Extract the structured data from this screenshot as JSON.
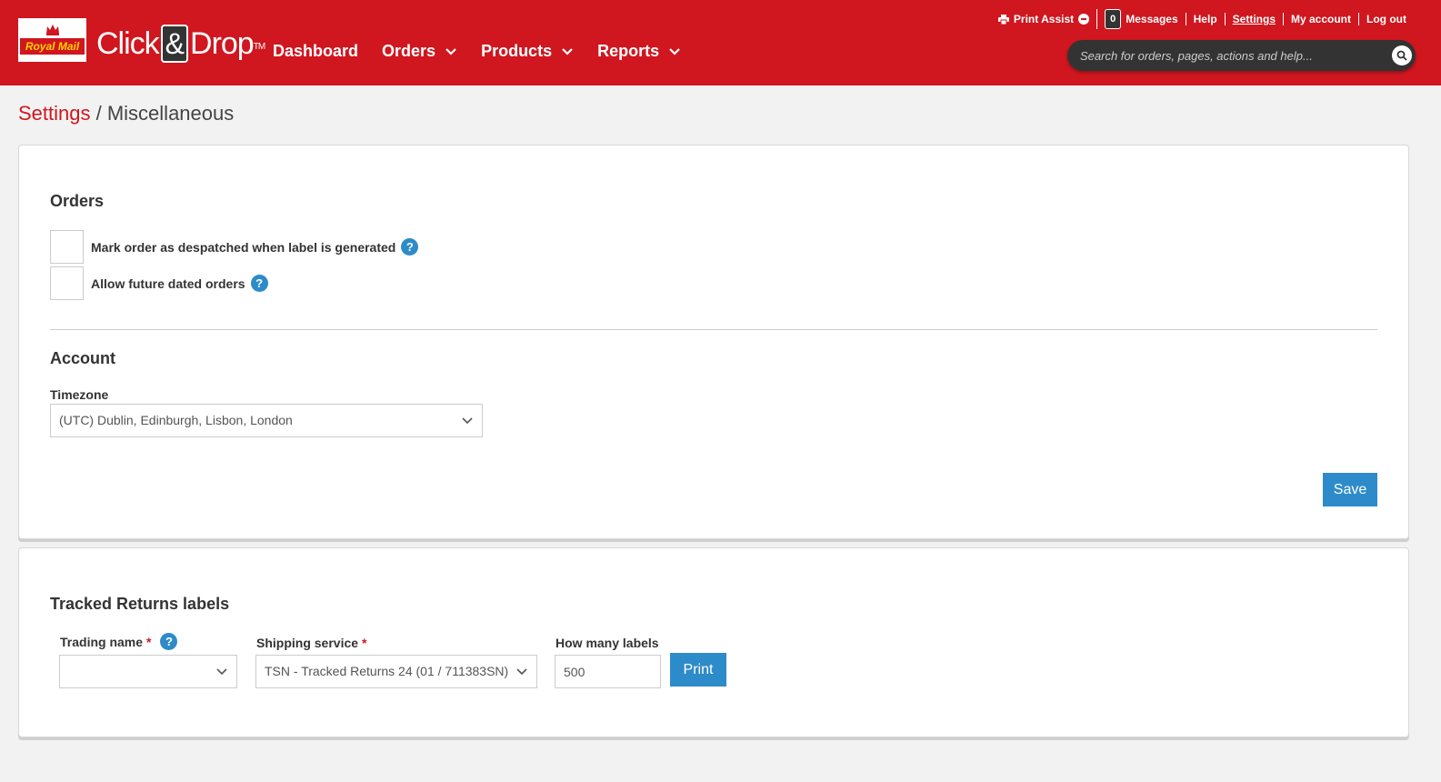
{
  "header": {
    "logo_text": "Royal Mail",
    "brand_pre": "Click",
    "brand_amp": "&",
    "brand_post": "Drop",
    "brand_tm": "TM",
    "nav": [
      {
        "label": "Dashboard"
      },
      {
        "label": "Orders"
      },
      {
        "label": "Products"
      },
      {
        "label": "Reports"
      }
    ],
    "toplinks": {
      "print_assist": "Print Assist",
      "message_count": "0",
      "messages": "Messages",
      "help": "Help",
      "settings": "Settings",
      "my_account": "My account",
      "log_out": "Log out"
    },
    "search_placeholder": "Search for orders, pages, actions and help..."
  },
  "breadcrumb": {
    "parent": "Settings",
    "separator": " / ",
    "current": "Miscellaneous"
  },
  "orders_section": {
    "title": "Orders",
    "options": [
      {
        "label": "Mark order as despatched when label is generated",
        "checked": false
      },
      {
        "label": "Allow future dated orders",
        "checked": false
      }
    ]
  },
  "account_section": {
    "title": "Account",
    "timezone_label": "Timezone",
    "timezone_value": "(UTC) Dublin, Edinburgh, Lisbon, London",
    "save_label": "Save"
  },
  "returns_section": {
    "title": "Tracked Returns labels",
    "trading_name_label": "Trading name",
    "trading_name_value": "",
    "shipping_service_label": "Shipping service",
    "shipping_service_value": "TSN - Tracked Returns 24 (01 / 711383SN)",
    "how_many_label": "How many labels",
    "how_many_value": "500",
    "print_label": "Print",
    "required_mark": "*"
  },
  "help_glyph": "?",
  "colors": {
    "brand_red": "#d0161f",
    "accent_blue": "#2e8bc9",
    "logo_yellow": "#ffd200"
  }
}
